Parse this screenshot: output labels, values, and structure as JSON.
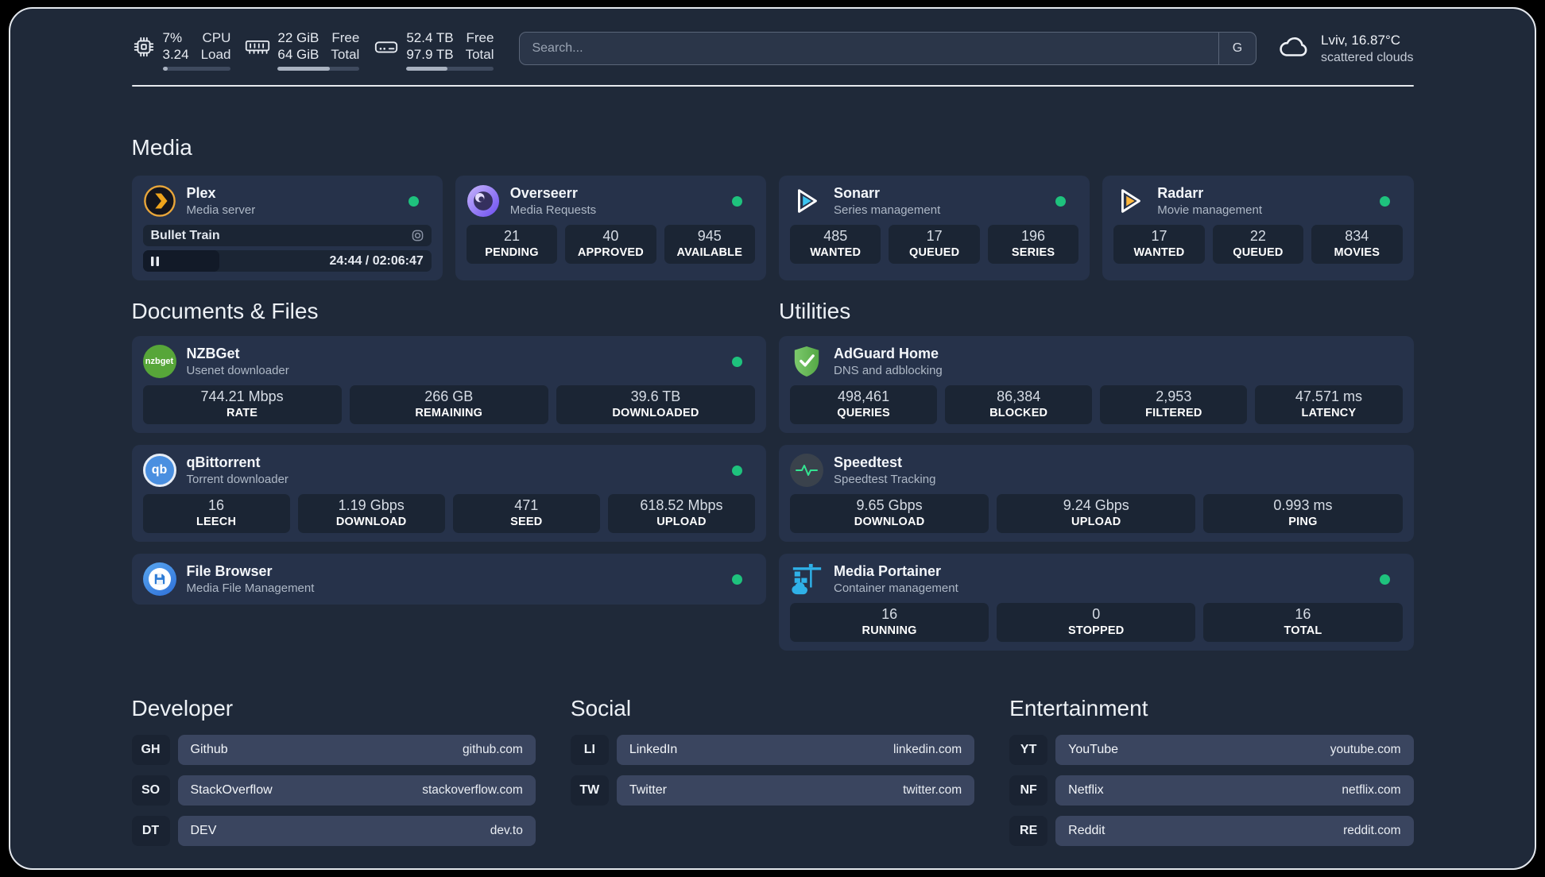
{
  "colors": {
    "background": "#000000",
    "panel": "#1f2939",
    "card": "#26324a",
    "tile": "#1b2534",
    "status_online": "#1ec27d",
    "divider": "#e7eaee",
    "bookmark_bar": "#3a455f",
    "plex_amber": "#efa41c",
    "sonarr_blue": "#3cc5f1",
    "radarr_amber": "#ffb73d"
  },
  "header": {
    "metrics": [
      {
        "icon": "cpu-icon",
        "values": [
          "7%",
          "3.24"
        ],
        "labels": [
          "CPU",
          "Load"
        ],
        "progress_pct": 8
      },
      {
        "icon": "memory-icon",
        "values": [
          "22 GiB",
          "64 GiB"
        ],
        "labels": [
          "Free",
          "Total"
        ],
        "progress_pct": 64
      },
      {
        "icon": "disk-icon",
        "values": [
          "52.4 TB",
          "97.9 TB"
        ],
        "labels": [
          "Free",
          "Total"
        ],
        "progress_pct": 47
      }
    ],
    "search": {
      "placeholder": "Search...",
      "engine_button": "G"
    },
    "weather": {
      "icon": "cloud-icon",
      "location_temp": "Lviv, 16.87°C",
      "condition": "scattered clouds"
    }
  },
  "media": {
    "title": "Media",
    "plex": {
      "name": "Plex",
      "subtitle": "Media server",
      "status": "online",
      "player": {
        "track": "Bullet Train",
        "time": "24:44 / 02:06:47",
        "state": "paused"
      }
    },
    "overseerr": {
      "name": "Overseerr",
      "subtitle": "Media Requests",
      "status": "online",
      "stats": [
        {
          "value": "21",
          "label": "PENDING"
        },
        {
          "value": "40",
          "label": "APPROVED"
        },
        {
          "value": "945",
          "label": "AVAILABLE"
        }
      ]
    },
    "sonarr": {
      "name": "Sonarr",
      "subtitle": "Series management",
      "status": "online",
      "stats": [
        {
          "value": "485",
          "label": "WANTED"
        },
        {
          "value": "17",
          "label": "QUEUED"
        },
        {
          "value": "196",
          "label": "SERIES"
        }
      ]
    },
    "radarr": {
      "name": "Radarr",
      "subtitle": "Movie management",
      "status": "online",
      "stats": [
        {
          "value": "17",
          "label": "WANTED"
        },
        {
          "value": "22",
          "label": "QUEUED"
        },
        {
          "value": "834",
          "label": "MOVIES"
        }
      ]
    }
  },
  "documents": {
    "title": "Documents & Files",
    "nzbget": {
      "name": "NZBGet",
      "subtitle": "Usenet downloader",
      "status": "online",
      "stats": [
        {
          "value": "744.21 Mbps",
          "label": "RATE"
        },
        {
          "value": "266 GB",
          "label": "REMAINING"
        },
        {
          "value": "39.6 TB",
          "label": "DOWNLOADED"
        }
      ]
    },
    "qbittorrent": {
      "name": "qBittorrent",
      "subtitle": "Torrent downloader",
      "status": "online",
      "stats": [
        {
          "value": "16",
          "label": "LEECH"
        },
        {
          "value": "1.19 Gbps",
          "label": "DOWNLOAD"
        },
        {
          "value": "471",
          "label": "SEED"
        },
        {
          "value": "618.52 Mbps",
          "label": "UPLOAD"
        }
      ]
    },
    "filebrowser": {
      "name": "File Browser",
      "subtitle": "Media File Management",
      "status": "online"
    }
  },
  "utilities": {
    "title": "Utilities",
    "adguard": {
      "name": "AdGuard Home",
      "subtitle": "DNS and adblocking",
      "stats": [
        {
          "value": "498,461",
          "label": "QUERIES"
        },
        {
          "value": "86,384",
          "label": "BLOCKED"
        },
        {
          "value": "2,953",
          "label": "FILTERED"
        },
        {
          "value": "47.571 ms",
          "label": "LATENCY"
        }
      ]
    },
    "speedtest": {
      "name": "Speedtest",
      "subtitle": "Speedtest Tracking",
      "stats": [
        {
          "value": "9.65 Gbps",
          "label": "DOWNLOAD"
        },
        {
          "value": "9.24 Gbps",
          "label": "UPLOAD"
        },
        {
          "value": "0.993 ms",
          "label": "PING"
        }
      ]
    },
    "portainer": {
      "name": "Media Portainer",
      "subtitle": "Container management",
      "status": "online",
      "stats": [
        {
          "value": "16",
          "label": "RUNNING"
        },
        {
          "value": "0",
          "label": "STOPPED"
        },
        {
          "value": "16",
          "label": "TOTAL"
        }
      ]
    }
  },
  "bookmarks": [
    {
      "title": "Developer",
      "links": [
        {
          "abbr": "GH",
          "name": "Github",
          "url": "github.com"
        },
        {
          "abbr": "SO",
          "name": "StackOverflow",
          "url": "stackoverflow.com"
        },
        {
          "abbr": "DT",
          "name": "DEV",
          "url": "dev.to"
        }
      ]
    },
    {
      "title": "Social",
      "links": [
        {
          "abbr": "LI",
          "name": "LinkedIn",
          "url": "linkedin.com"
        },
        {
          "abbr": "TW",
          "name": "Twitter",
          "url": "twitter.com"
        }
      ]
    },
    {
      "title": "Entertainment",
      "links": [
        {
          "abbr": "YT",
          "name": "YouTube",
          "url": "youtube.com"
        },
        {
          "abbr": "NF",
          "name": "Netflix",
          "url": "netflix.com"
        },
        {
          "abbr": "RE",
          "name": "Reddit",
          "url": "reddit.com"
        }
      ]
    }
  ]
}
